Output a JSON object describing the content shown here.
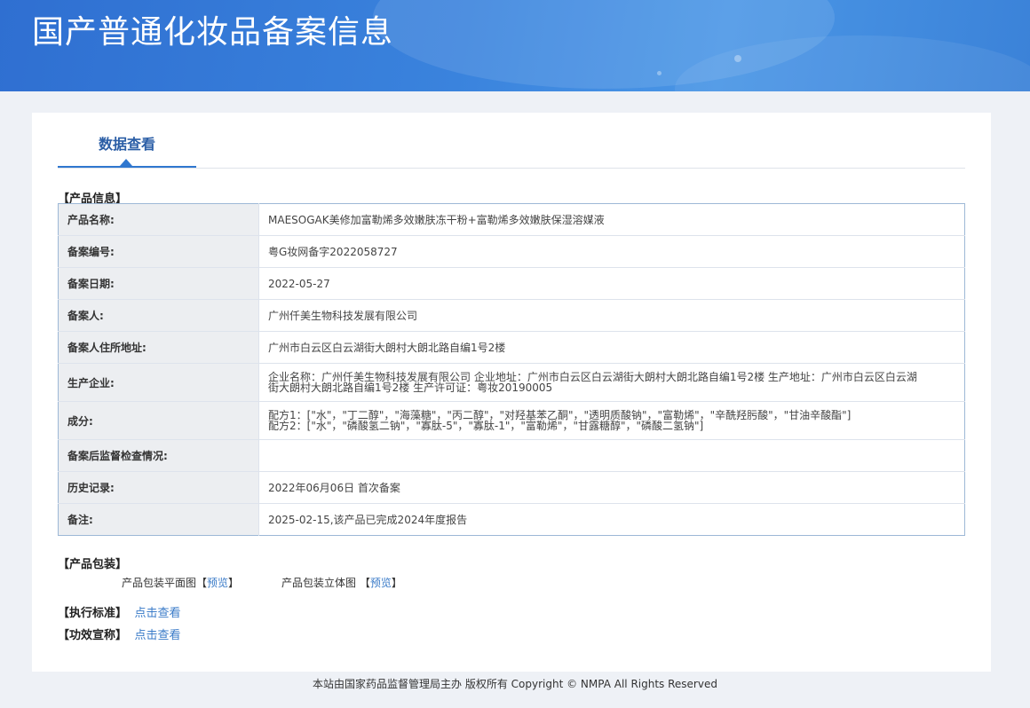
{
  "header": {
    "title": "国产普通化妆品备案信息"
  },
  "tabs": [
    {
      "label": "数据查看"
    }
  ],
  "product_info": {
    "section_label": "【产品信息】",
    "rows": [
      {
        "key": "产品名称:",
        "value": "MAESOGAK美修加富勒烯多效嫩肤冻干粉+富勒烯多效嫩肤保湿溶媒液"
      },
      {
        "key": "备案编号:",
        "value": "粤G妆网备字2022058727"
      },
      {
        "key": "备案日期:",
        "value": "2022-05-27"
      },
      {
        "key": "备案人:",
        "value": "广州仟美生物科技发展有限公司"
      },
      {
        "key": "备案人住所地址:",
        "value": "广州市白云区白云湖街大朗村大朗北路自编1号2楼"
      },
      {
        "key": "生产企业:",
        "value_lines": [
          "企业名称：广州仟美生物科技发展有限公司 企业地址：广州市白云区白云湖街大朗村大朗北路自编1号2楼 生产地址：广州市白云区白云湖",
          "街大朗村大朗北路自编1号2楼 生产许可证：粤妆20190005"
        ]
      },
      {
        "key": "成分:",
        "value_lines": [
          "配方1：[\"水\"，\"丁二醇\"，\"海藻糖\"，\"丙二醇\"，\"对羟基苯乙酮\"，\"透明质酸钠\"，\"富勒烯\"，\"辛酰羟肟酸\"，\"甘油辛酸酯\"]",
          "配方2：[\"水\"，\"磷酸氢二钠\"，\"寡肽-5\"，\"寡肽-1\"，\"富勒烯\"，\"甘露糖醇\"，\"磷酸二氢钠\"]"
        ]
      },
      {
        "key": "备案后监督检查情况:",
        "value": ""
      },
      {
        "key": "历史记录:",
        "value": "2022年06月06日 首次备案"
      },
      {
        "key": "备注:",
        "value": "2025-02-15,该产品已完成2024年度报告"
      }
    ]
  },
  "packaging": {
    "section_label": "【产品包装】",
    "flat_label": "产品包装平面图",
    "flat_link": "预览",
    "solid_label": "产品包装立体图",
    "solid_link": "预览",
    "bracket_open": "【",
    "bracket_close": "】"
  },
  "standard": {
    "label": "【执行标准】",
    "link": "点击查看"
  },
  "efficacy": {
    "label": "【功效宣称】",
    "link": "点击查看"
  },
  "footer": {
    "text": "本站由国家药品监督管理局主办 版权所有 Copyright © NMPA All Rights Reserved"
  }
}
